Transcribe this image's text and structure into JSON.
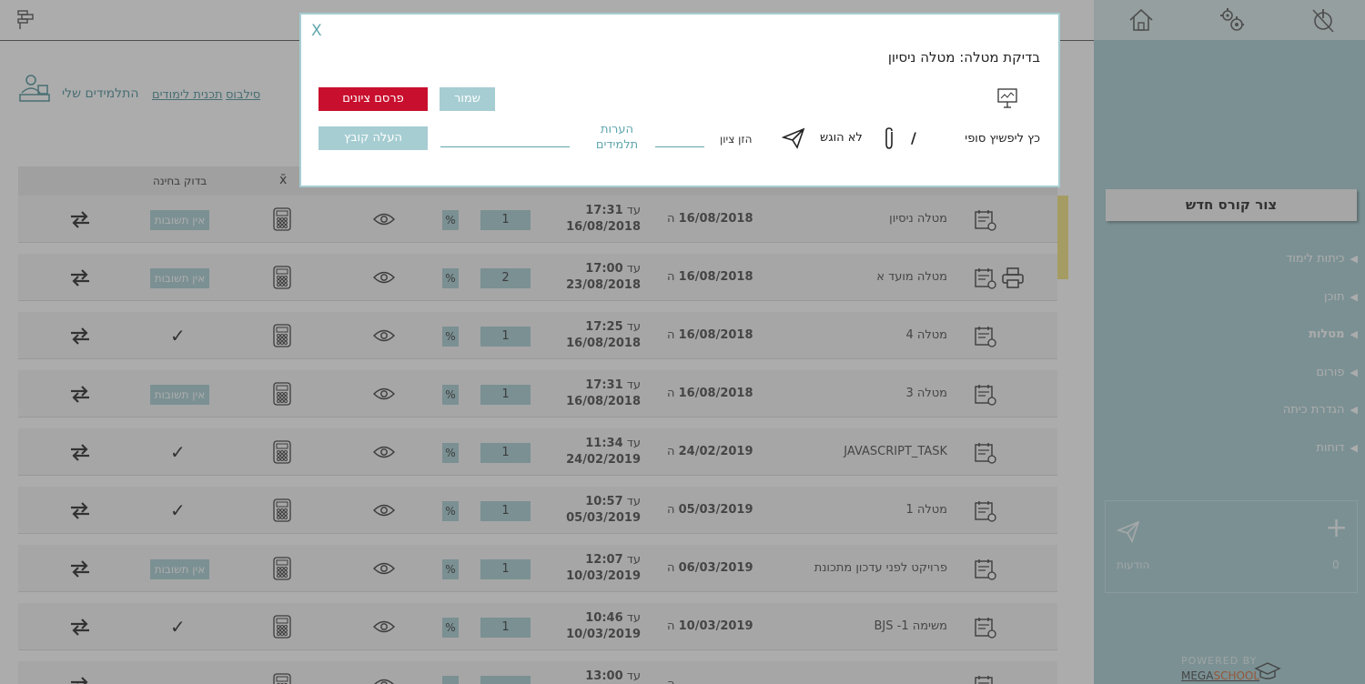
{
  "sidebar": {
    "new_course": "צור קורס חדש",
    "menu": [
      {
        "label": "כיתות לימוד",
        "active": false
      },
      {
        "label": "תוכן",
        "active": false
      },
      {
        "label": "מטלות",
        "active": true
      },
      {
        "label": "פורום",
        "active": false
      },
      {
        "label": "הגדרת כיתה",
        "active": false
      },
      {
        "label": "דוחות",
        "active": false
      }
    ],
    "messages_label": "הודעות",
    "messages_count": "0",
    "powered_by": "POWERED BY",
    "brand_a": "MEGA",
    "brand_b": "SCHOOL"
  },
  "subnav": {
    "syllabus": "סילבוס",
    "curriculum": "תכנית לימודים",
    "my_students": "התלמידים שלי"
  },
  "table": {
    "col_check": "בדוק בחינה",
    "col_avg": "x̄",
    "start_prefix": "ה",
    "due_prefix": "עד",
    "rows": [
      {
        "name": "מטלה ניסיון",
        "start": "16/08/2018",
        "due_time": "17:31",
        "due_date": "16/08/2018",
        "count": "1",
        "pct": "%",
        "status": "אין תשובות",
        "printer": false
      },
      {
        "name": "מטלה מועד א",
        "start": "16/08/2018",
        "due_time": "17:00",
        "due_date": "23/08/2018",
        "count": "2",
        "pct": "%",
        "status": "אין תשובות",
        "printer": true
      },
      {
        "name": "מטלה 4",
        "start": "16/08/2018",
        "due_time": "17:25",
        "due_date": "16/08/2018",
        "count": "1",
        "pct": "%",
        "status": "✓",
        "printer": false
      },
      {
        "name": "מטלה 3",
        "start": "16/08/2018",
        "due_time": "17:31",
        "due_date": "16/08/2018",
        "count": "1",
        "pct": "%",
        "status": "אין תשובות",
        "printer": false
      },
      {
        "name": "JAVASCRIPT_TASK",
        "start": "24/02/2019",
        "due_time": "11:34",
        "due_date": "24/02/2019",
        "count": "1",
        "pct": "%",
        "status": "✓",
        "printer": false
      },
      {
        "name": "מטלה 1",
        "start": "05/03/2019",
        "due_time": "10:57",
        "due_date": "05/03/2019",
        "count": "1",
        "pct": "%",
        "status": "✓",
        "printer": false
      },
      {
        "name": "פרויקט לפני עדכון מתכונת",
        "start": "06/03/2019",
        "due_time": "12:07",
        "due_date": "10/03/2019",
        "count": "1",
        "pct": "%",
        "status": "אין תשובות",
        "printer": false
      },
      {
        "name": "משימה 1- BJS",
        "start": "10/03/2019",
        "due_time": "10:46",
        "due_date": "10/03/2019",
        "count": "1",
        "pct": "%",
        "status": "✓",
        "printer": false
      },
      {
        "name": "",
        "start": "",
        "due_time": "13:00",
        "due_date": "",
        "count": "",
        "pct": "",
        "status": "",
        "printer": false
      }
    ]
  },
  "modal": {
    "close": "X",
    "title": "בדיקת מטלה: מטלה ניסיון",
    "publish_grades": "פרסם ציונים",
    "save": "שמור",
    "upload_file": "העלה קובץ",
    "student_comments": "הערות תלמידים",
    "enter_grade": "הזן ציון",
    "submission_status": "לא הוגש",
    "slash": "/",
    "student_name": "כץ ליפשיץ סופי"
  },
  "colors": {
    "accent": "#a6cdd2",
    "accent_text": "#5fa6ae",
    "publish": "#c8102e",
    "highlight": "#f2e27a"
  }
}
